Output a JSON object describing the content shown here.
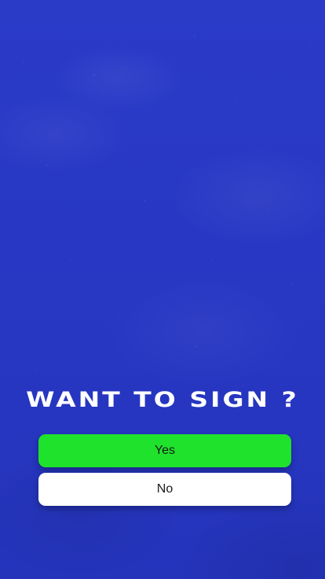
{
  "prompt": {
    "title": "WANT TO SIGN ?"
  },
  "actions": {
    "yes_label": "Yes",
    "no_label": "No"
  },
  "colors": {
    "background": "#2738c4",
    "yes_button": "#1fe22d",
    "no_button": "#ffffff",
    "title_text": "#ffffff"
  }
}
